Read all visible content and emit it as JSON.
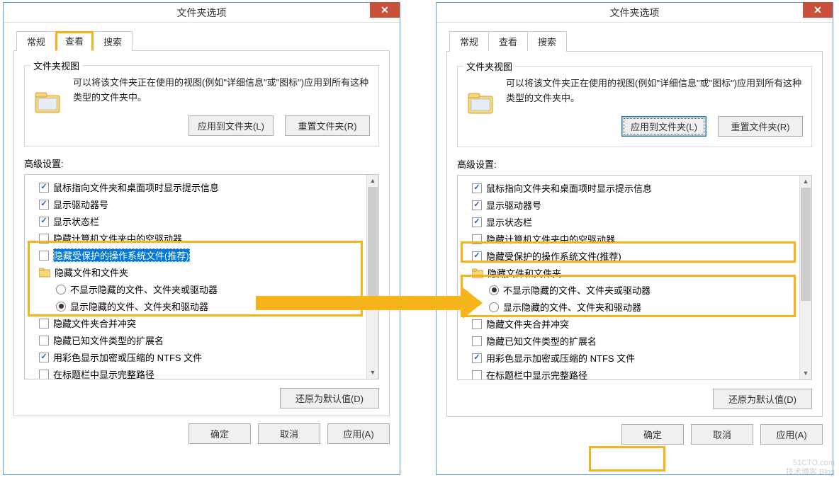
{
  "window": {
    "title": "文件夹选项",
    "close": "✕"
  },
  "tabs": {
    "general": "常规",
    "view": "查看",
    "search": "搜索"
  },
  "group": {
    "title": "文件夹视图",
    "text1": "可以将该文件夹正在使用的视图(例如\"详细信息\"或\"图标\")应用到所有这种类型的文件夹中。",
    "apply_btn": "应用到文件夹(L)",
    "reset_btn": "重置文件夹(R)"
  },
  "advanced_label": "高级设置:",
  "items_left": [
    {
      "kind": "chk",
      "checked": true,
      "label": "鼠标指向文件夹和桌面项时显示提示信息"
    },
    {
      "kind": "chk",
      "checked": true,
      "label": "显示驱动器号"
    },
    {
      "kind": "chk",
      "checked": true,
      "label": "显示状态栏"
    },
    {
      "kind": "chk-cut",
      "checked": false,
      "label": "隐藏计算机文件夹中的空驱动器"
    },
    {
      "kind": "chk",
      "checked": false,
      "label": "隐藏受保护的操作系统文件(推荐)",
      "hl": true
    },
    {
      "kind": "folder",
      "label": "隐藏文件和文件夹"
    },
    {
      "kind": "radio",
      "selected": false,
      "indent": 1,
      "label": "不显示隐藏的文件、文件夹或驱动器"
    },
    {
      "kind": "radio",
      "selected": true,
      "indent": 1,
      "label": "显示隐藏的文件、文件夹和驱动器"
    },
    {
      "kind": "chk",
      "checked": false,
      "label": "隐藏文件夹合并冲突"
    },
    {
      "kind": "chk",
      "checked": false,
      "label": "隐藏已知文件类型的扩展名"
    },
    {
      "kind": "chk",
      "checked": true,
      "label": "用彩色显示加密或压缩的 NTFS 文件"
    },
    {
      "kind": "chk",
      "checked": false,
      "label": "在标题栏中显示完整路径"
    }
  ],
  "items_right": [
    {
      "kind": "chk",
      "checked": true,
      "label": "鼠标指向文件夹和桌面项时显示提示信息"
    },
    {
      "kind": "chk",
      "checked": true,
      "label": "显示驱动器号"
    },
    {
      "kind": "chk",
      "checked": true,
      "label": "显示状态栏"
    },
    {
      "kind": "chk-cut",
      "checked": false,
      "label": "隐藏计算机文件夹中的空驱动器"
    },
    {
      "kind": "chk",
      "checked": true,
      "label": "隐藏受保护的操作系统文件(推荐)"
    },
    {
      "kind": "folder-cut",
      "label": "隐藏文件和文件夹"
    },
    {
      "kind": "radio",
      "selected": true,
      "indent": 1,
      "label": "不显示隐藏的文件、文件夹或驱动器"
    },
    {
      "kind": "radio",
      "selected": false,
      "indent": 1,
      "label": "显示隐藏的文件、文件夹和驱动器"
    },
    {
      "kind": "chk",
      "checked": false,
      "label": "隐藏文件夹合并冲突"
    },
    {
      "kind": "chk",
      "checked": false,
      "label": "隐藏已知文件类型的扩展名"
    },
    {
      "kind": "chk",
      "checked": true,
      "label": "用彩色显示加密或压缩的 NTFS 文件"
    },
    {
      "kind": "chk",
      "checked": false,
      "label": "在标题栏中显示完整路径"
    }
  ],
  "restore_btn": "还原为默认值(D)",
  "footer": {
    "ok": "确定",
    "cancel": "取消",
    "apply": "应用(A)"
  },
  "watermark": {
    "l1": "51CTO.com",
    "l2": "技术博客  Blog"
  }
}
